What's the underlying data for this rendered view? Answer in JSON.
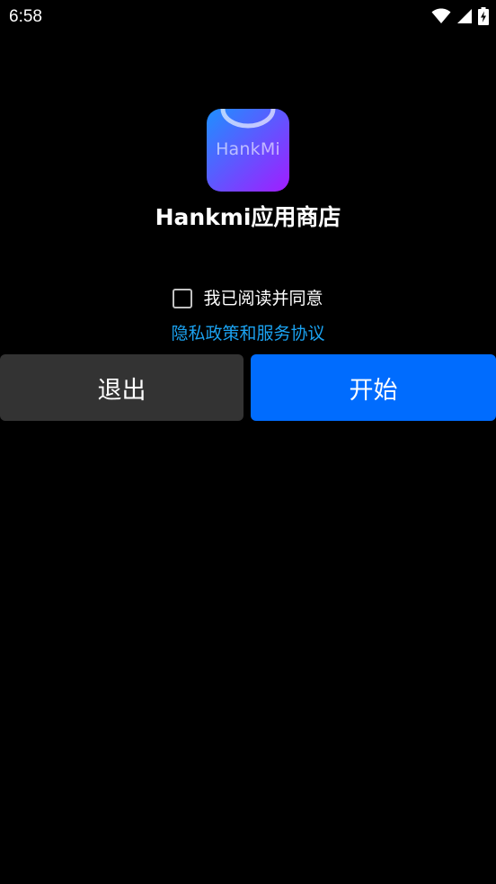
{
  "status_bar": {
    "time": "6:58",
    "icons": [
      "wifi-icon",
      "signal-icon",
      "battery-charging-icon"
    ]
  },
  "app": {
    "icon_text": "HankMi",
    "title": "Hankmi应用商店",
    "colors": {
      "icon_gradient_start": "#1e90ff",
      "icon_gradient_end": "#a21cff"
    }
  },
  "agreement": {
    "checked": false,
    "label": "我已阅读并同意",
    "link": "隐私政策和服务协议",
    "link_color": "#1ba2f0"
  },
  "buttons": {
    "exit_label": "退出",
    "start_label": "开始",
    "exit_color": "#333333",
    "start_color": "#006cfe"
  }
}
